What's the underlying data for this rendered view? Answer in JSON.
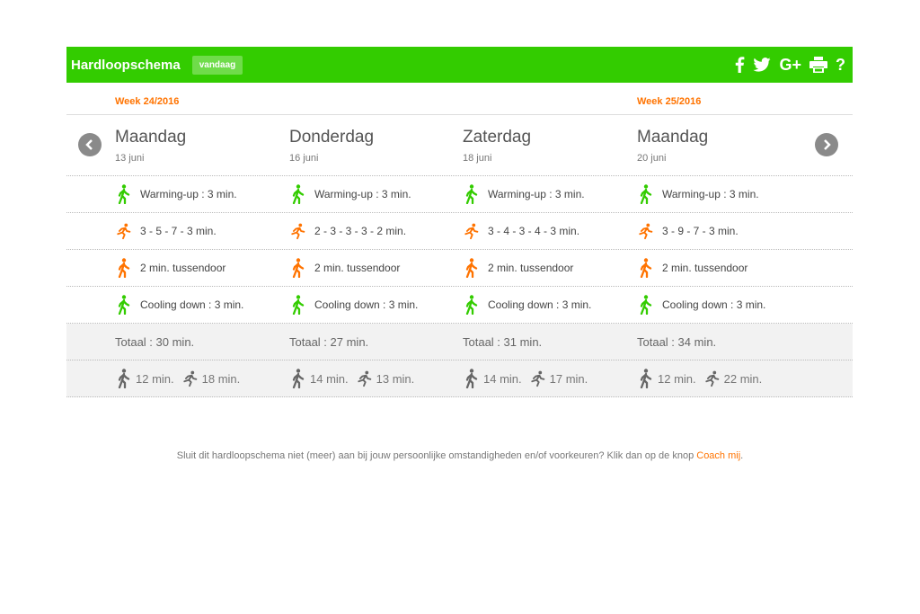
{
  "header": {
    "title": "Hardloopschema",
    "today_label": "vandaag",
    "share_icons": [
      "facebook-icon",
      "twitter-icon",
      "google-plus-icon",
      "print-icon",
      "help-icon"
    ],
    "google_label": "G+",
    "help_label": "?"
  },
  "weeks": [
    "Week 24/2016",
    "Week 25/2016"
  ],
  "days": [
    {
      "name": "Maandag",
      "date": "13 juni"
    },
    {
      "name": "Donderdag",
      "date": "16 juni"
    },
    {
      "name": "Zaterdag",
      "date": "18 juni"
    },
    {
      "name": "Maandag",
      "date": "20 juni"
    }
  ],
  "rows": [
    {
      "icon": "walk-icon",
      "color": "#33cc00",
      "cells": [
        "Warming-up : 3 min.",
        "Warming-up : 3 min.",
        "Warming-up : 3 min.",
        "Warming-up : 3 min."
      ]
    },
    {
      "icon": "run-icon",
      "color": "#ff7300",
      "cells": [
        "3 - 5 - 7 - 3 min.",
        "2 - 3 - 3 - 3 - 2 min.",
        "3 - 4 - 3 - 4 - 3 min.",
        "3 - 9 - 7 - 3 min."
      ]
    },
    {
      "icon": "walk-icon",
      "color": "#ff7300",
      "cells": [
        "2 min. tussendoor",
        "2 min. tussendoor",
        "2 min. tussendoor",
        "2 min. tussendoor"
      ]
    },
    {
      "icon": "walk-icon",
      "color": "#33cc00",
      "cells": [
        "Cooling down : 3 min.",
        "Cooling down : 3 min.",
        "Cooling down : 3 min.",
        "Cooling down : 3 min."
      ]
    }
  ],
  "totals": [
    "Totaal : 30 min.",
    "Totaal : 27 min.",
    "Totaal : 31 min.",
    "Totaal : 34 min."
  ],
  "splits": [
    {
      "walk": "12 min.",
      "run": "18 min."
    },
    {
      "walk": "14 min.",
      "run": "13 min."
    },
    {
      "walk": "14 min.",
      "run": "17 min."
    },
    {
      "walk": "12 min.",
      "run": "22 min."
    }
  ],
  "footer": {
    "text": "Sluit dit hardloopschema niet (meer) aan bij jouw persoonlijke omstandigheden en/of voorkeuren? Klik dan op de knop ",
    "link": "Coach mij",
    "end": "."
  },
  "colors": {
    "brand_green": "#33cc00",
    "accent_orange": "#ff7300",
    "icon_gray": "#666666"
  }
}
